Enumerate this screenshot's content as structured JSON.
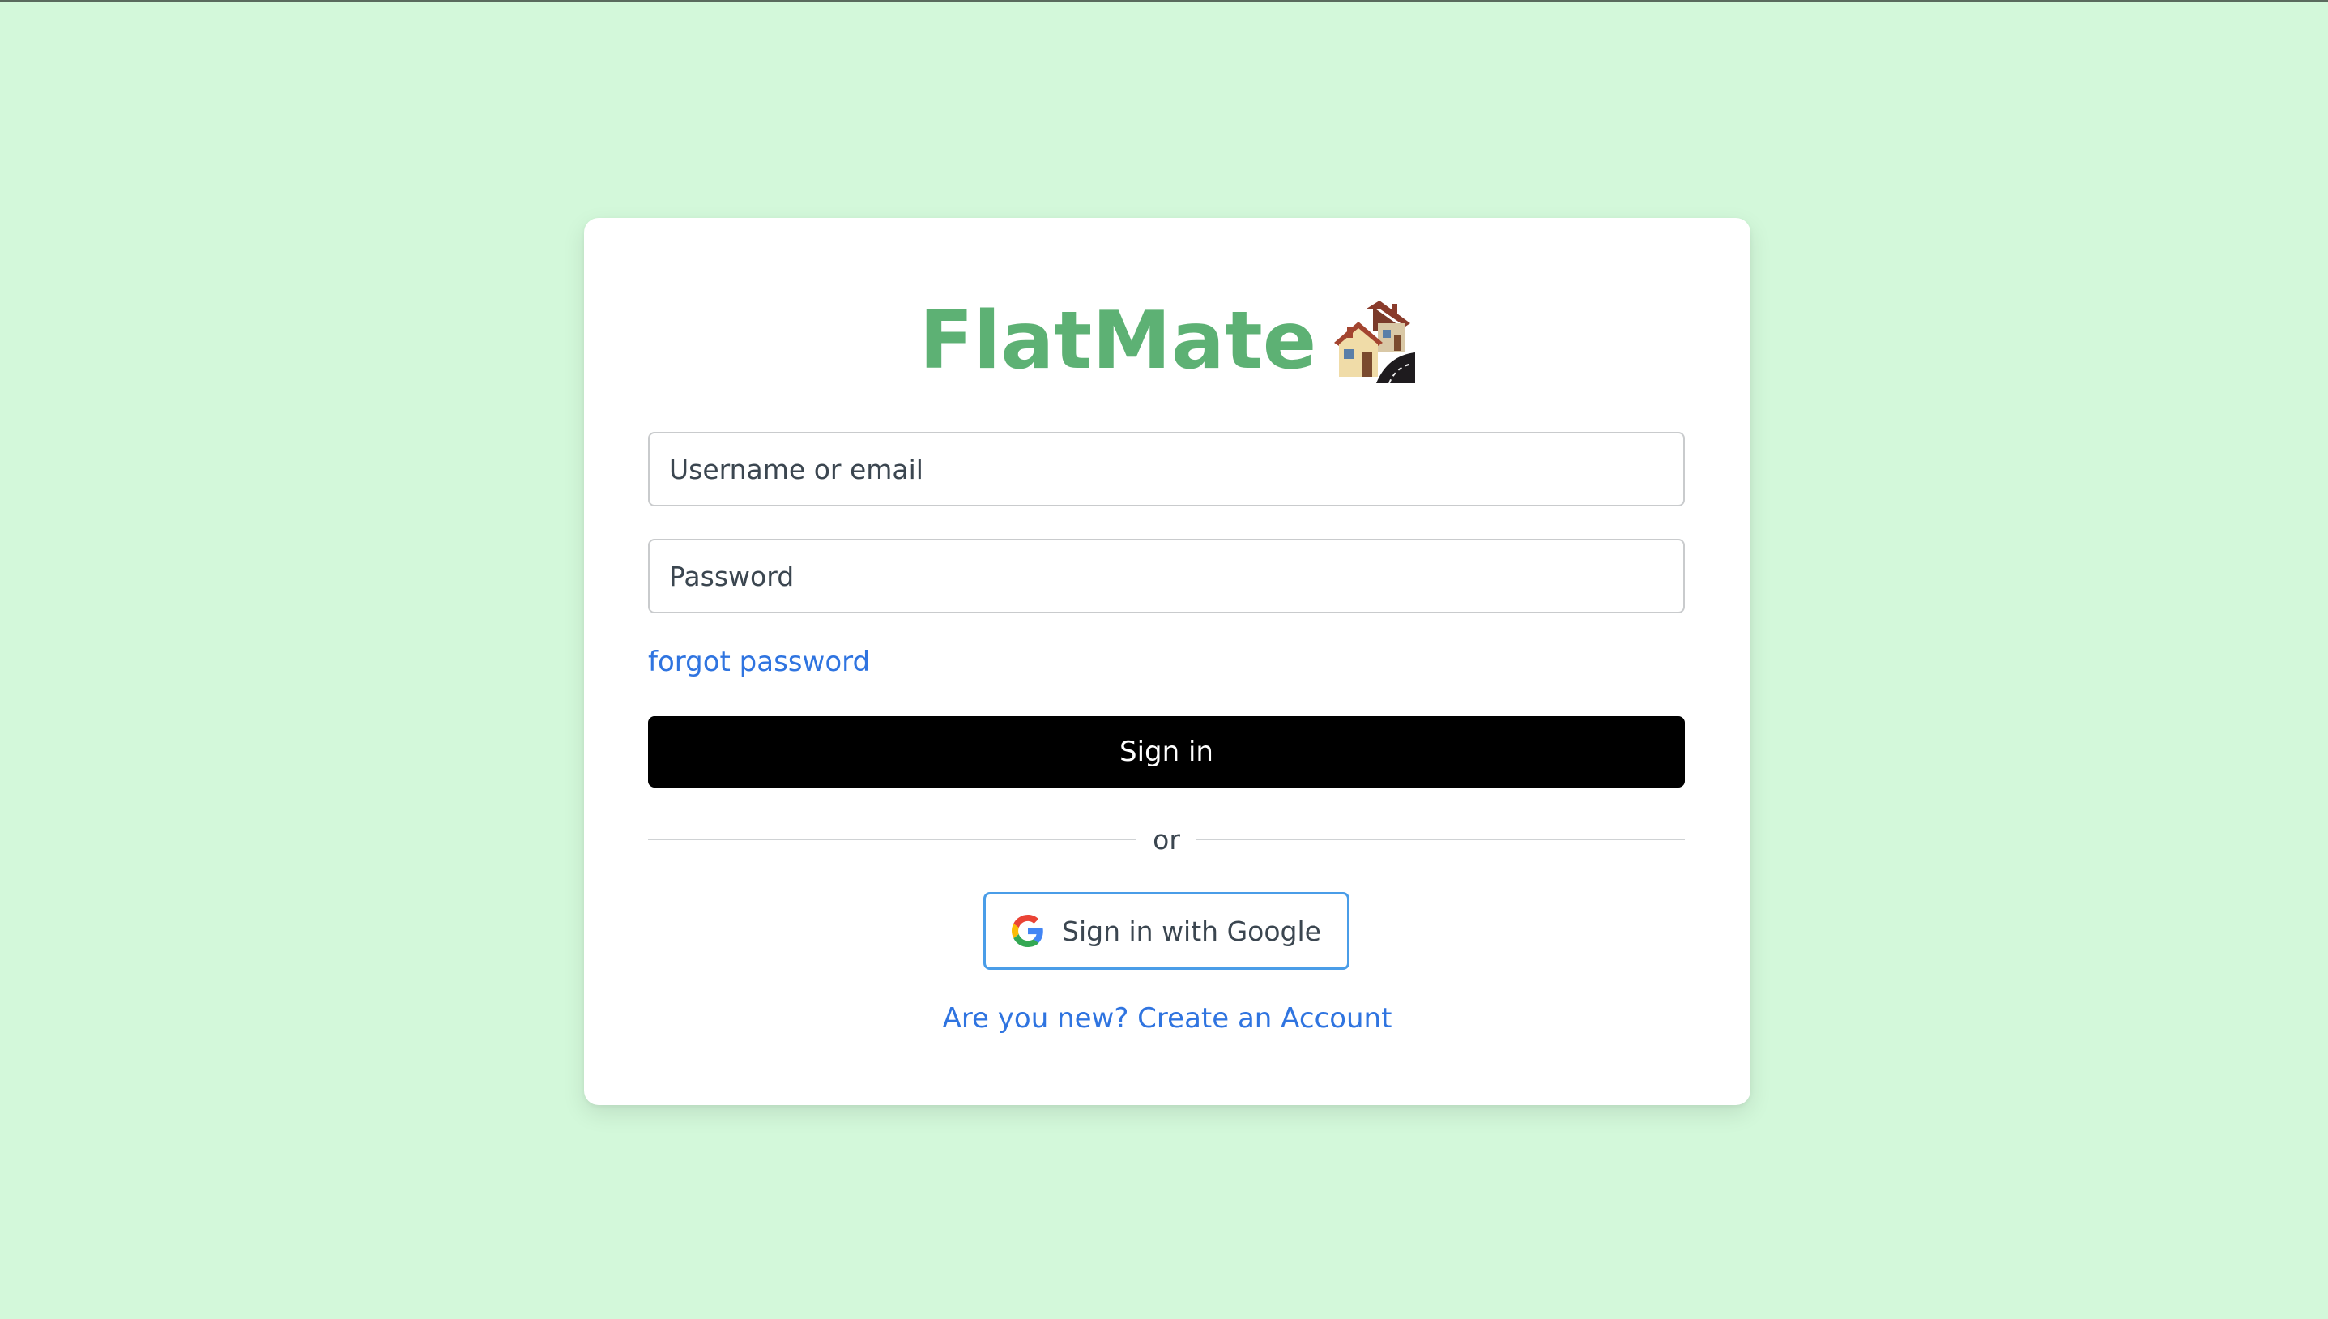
{
  "brand": {
    "name": "FlatMate",
    "icon": "houses-icon",
    "color": "#5db174"
  },
  "form": {
    "username_placeholder": "Username or email",
    "password_placeholder": "Password",
    "forgot_label": "forgot password",
    "signin_label": "Sign in",
    "divider_label": "or",
    "google_label": "Sign in with Google",
    "create_label": "Are you new? Create an Account"
  },
  "colors": {
    "background": "#d3f8da",
    "link": "#2f74e0",
    "primary_button": "#000000",
    "google_border": "#4a9de8"
  }
}
